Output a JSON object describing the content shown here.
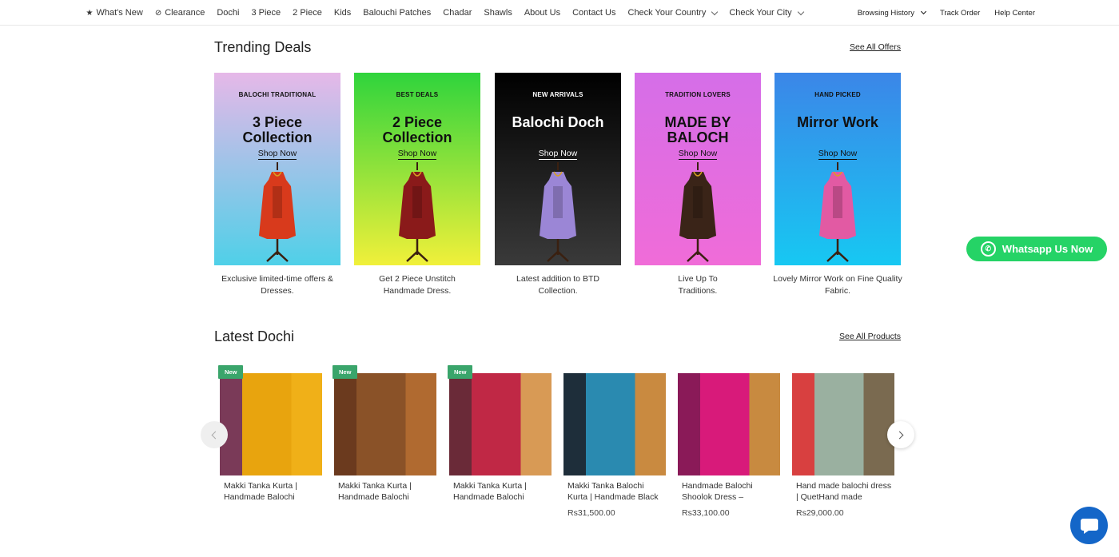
{
  "nav": {
    "left": [
      {
        "label": "What's New",
        "icon": "star-icon"
      },
      {
        "label": "Clearance",
        "icon": "tag-icon"
      },
      {
        "label": "Dochi"
      },
      {
        "label": "3 Piece"
      },
      {
        "label": "2 Piece"
      },
      {
        "label": "Kids"
      },
      {
        "label": "Balouchi Patches"
      },
      {
        "label": "Chadar"
      },
      {
        "label": "Shawls"
      },
      {
        "label": "About Us"
      },
      {
        "label": "Contact Us"
      },
      {
        "label": "Check Your Country",
        "dropdown": true
      },
      {
        "label": "Check Your City",
        "dropdown": true
      }
    ],
    "right": [
      {
        "label": "Browsing History",
        "dropdown": true
      },
      {
        "label": "Track Order"
      },
      {
        "label": "Help Center"
      }
    ]
  },
  "trending": {
    "title": "Trending Deals",
    "see_all": "See All Offers",
    "cards": [
      {
        "tag": "BALOCHI TRADITIONAL",
        "headline": "3 Piece Collection",
        "shop": "Shop Now",
        "desc": "Exclusive limited-time offers & Dresses.",
        "colors": [
          "#e6b8e8",
          "#4fd0e8"
        ],
        "text_color": "#111111",
        "dress_color": "#d83a1c"
      },
      {
        "tag": "BEST DEALS",
        "headline": "2 Piece Collection",
        "shop": "Shop Now",
        "desc": "Get 2 Piece Unstitch Handmade Dress.",
        "colors": [
          "#2fd43c",
          "#f1f03a"
        ],
        "text_color": "#111111",
        "dress_color": "#8a1a1a"
      },
      {
        "tag": "NEW ARRIVALS",
        "headline": "Balochi Doch",
        "shop": "Shop Now",
        "desc": "Latest addition to BTD Collection.",
        "colors": [
          "#000000",
          "#3a3a3a"
        ],
        "text_color": "#ffffff",
        "dress_color": "#9b86d6"
      },
      {
        "tag": "TRADITION LOVERS",
        "headline": "MADE BY BALOCH",
        "shop": "Shop Now",
        "desc": "Live Up To Traditions.",
        "colors": [
          "#d56ee8",
          "#f06cd8"
        ],
        "text_color": "#111111",
        "dress_color": "#3a2418"
      },
      {
        "tag": "HAND PICKED",
        "headline": "Mirror Work",
        "shop": "Shop Now",
        "desc": "Lovely Mirror Work on Fine Quality Fabric.",
        "colors": [
          "#3b86e8",
          "#17c8f2"
        ],
        "text_color": "#111111",
        "dress_color": "#e25aa3"
      }
    ]
  },
  "latest": {
    "title": "Latest Dochi",
    "see_all": "See All Products",
    "products": [
      {
        "badge": "New",
        "name": "Makki Tanka Kurta | Handmade Balochi",
        "price": "",
        "colors": [
          "#7a3a58",
          "#e8a40e",
          "#f0b018"
        ]
      },
      {
        "badge": "New",
        "name": "Makki Tanka Kurta | Handmade Balochi",
        "price": "",
        "colors": [
          "#6b3a1e",
          "#8a5228",
          "#b06a30"
        ]
      },
      {
        "badge": "New",
        "name": "Makki Tanka Kurta | Handmade Balochi",
        "price": "",
        "colors": [
          "#6a2a38",
          "#c02845",
          "#d89a55"
        ]
      },
      {
        "badge": "",
        "name": "Makki Tanka Balochi Kurta | Handmade Black",
        "price": "Rs31,500.00",
        "colors": [
          "#1e2e3a",
          "#2a8ab0",
          "#c98a40"
        ]
      },
      {
        "badge": "",
        "name": "Handmade Balochi Shoolok Dress –",
        "price": "Rs33,100.00",
        "colors": [
          "#8a1a58",
          "#d81a7a",
          "#c88a40"
        ]
      },
      {
        "badge": "",
        "name": "Hand made balochi dress | QuetHand made",
        "price": "Rs29,000.00",
        "colors": [
          "#d84040",
          "#9ab0a0",
          "#7a6a50"
        ]
      }
    ]
  },
  "whatsapp": {
    "label": "Whatsapp Us Now",
    "color": "#25d366"
  },
  "chat": {
    "color": "#1466c8"
  }
}
